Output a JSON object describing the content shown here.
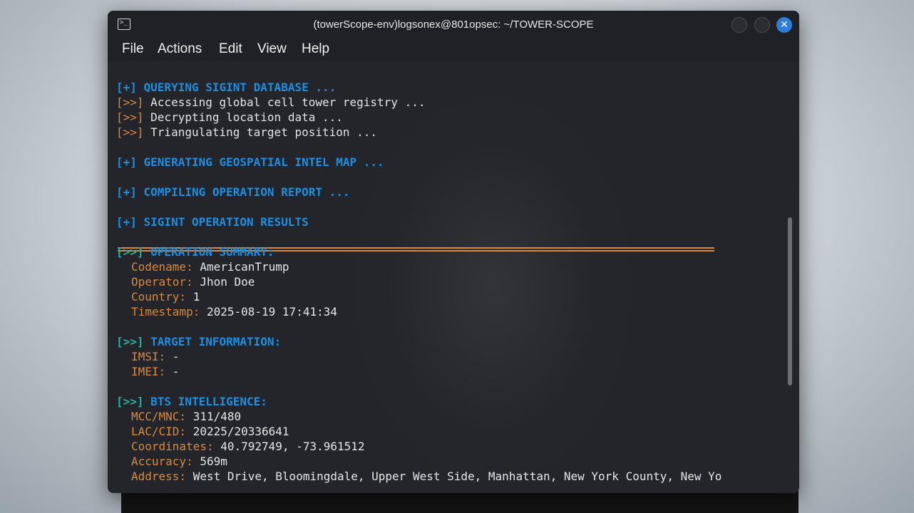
{
  "window": {
    "title": "(towerScope-env)logsonex@801opsec: ~/TOWER-SCOPE",
    "close_glyph": "✕"
  },
  "menu": [
    "File",
    "Actions",
    "Edit",
    "View",
    "Help"
  ],
  "terminal": {
    "sections": {
      "query": {
        "header": "[+] QUERYING SIGINT DATABASE ...",
        "steps": [
          {
            "prefix": "[>>]",
            "text": " Accessing global cell tower registry ..."
          },
          {
            "prefix": "[>>]",
            "text": " Decrypting location data ..."
          },
          {
            "prefix": "[>>]",
            "text": " Triangulating target position ..."
          }
        ]
      },
      "geo": "[+] GENERATING GEOSPATIAL INTEL MAP ...",
      "report": "[+] COMPILING OPERATION REPORT ...",
      "results": "[+] SIGINT OPERATION RESULTS"
    },
    "summary": {
      "prefix": "[>>]",
      "title": " OPERATION SUMMARY:",
      "fields": [
        {
          "label": "Codename:",
          "value": " AmericanTrump"
        },
        {
          "label": "Operator:",
          "value": " Jhon Doe"
        },
        {
          "label": "Country:",
          "value": " 1"
        },
        {
          "label": "Timestamp:",
          "value": " 2025-08-19 17:41:34"
        }
      ]
    },
    "target": {
      "prefix": "[>>]",
      "title": " TARGET INFORMATION:",
      "fields": [
        {
          "label": "IMSI:",
          "value": " -"
        },
        {
          "label": "IMEI:",
          "value": " -"
        }
      ]
    },
    "bts": {
      "prefix": "[>>]",
      "title": " BTS INTELLIGENCE:",
      "fields": [
        {
          "label": "MCC/MNC:",
          "value": " 311/480"
        },
        {
          "label": "LAC/CID:",
          "value": " 20225/20336641"
        },
        {
          "label": "Coordinates:",
          "value": " 40.792749, -73.961512"
        },
        {
          "label": "Accuracy:",
          "value": " 569m"
        },
        {
          "label": "Address:",
          "value": " West Drive, Bloomingdale, Upper West Side, Manhattan, New York County, New Yo"
        }
      ]
    }
  },
  "colors": {
    "accent_blue": "#1c8fe0",
    "label_orange": "#d88a3a",
    "prefix_teal": "#27b0a0",
    "terminal_bg": "#23252b",
    "close_button": "#2d7ddb"
  },
  "icons": {
    "terminal": "terminal-icon",
    "minimize": "minimize-icon",
    "maximize": "maximize-icon",
    "close": "close-icon"
  }
}
